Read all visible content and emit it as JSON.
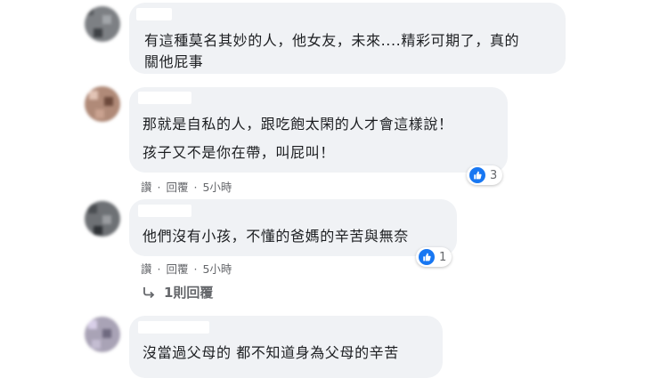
{
  "comments": [
    {
      "text_lines": [
        "有這種莫名其妙的人，他女友，未來....精彩可期了，真的",
        "關他屁事"
      ]
    },
    {
      "text_lines": [
        "那就是自私的人，跟吃飽太閑的人才會這樣說！",
        "孩子又不是你在帶，叫屁叫！"
      ],
      "actions": {
        "like": "讚",
        "reply": "回覆",
        "time": "5小時"
      },
      "reaction_count": "3"
    },
    {
      "text_lines": [
        "他們沒有小孩，不懂的爸媽的辛苦與無奈"
      ],
      "actions": {
        "like": "讚",
        "reply": "回覆",
        "time": "5小時"
      },
      "reaction_count": "1",
      "replies_label": "1則回覆"
    },
    {
      "text_lines": [
        "沒當過父母的 都不知道身為父母的辛苦"
      ]
    }
  ],
  "colors": {
    "bubble": "#f0f2f5",
    "like_blue": "#1877f2",
    "meta_gray": "#65676b"
  }
}
